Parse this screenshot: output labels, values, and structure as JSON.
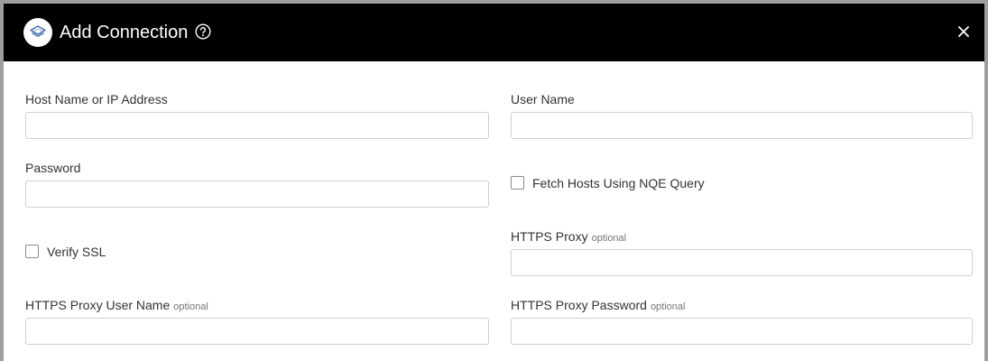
{
  "dialog": {
    "title": "Add Connection",
    "icons": {
      "logo": "layers-logo-icon",
      "help": "help-circle-icon",
      "close": "close-icon"
    }
  },
  "form": {
    "host": {
      "label": "Host Name or IP Address",
      "value": ""
    },
    "username": {
      "label": "User Name",
      "value": ""
    },
    "password": {
      "label": "Password",
      "value": ""
    },
    "fetch_hosts": {
      "label": "Fetch Hosts Using NQE Query",
      "checked": false
    },
    "verify_ssl": {
      "label": "Verify SSL",
      "checked": false
    },
    "https_proxy": {
      "label": "HTTPS Proxy",
      "optional": "optional",
      "value": ""
    },
    "proxy_username": {
      "label": "HTTPS Proxy User Name",
      "optional": "optional",
      "value": ""
    },
    "proxy_password": {
      "label": "HTTPS Proxy Password",
      "optional": "optional",
      "value": ""
    }
  },
  "colors": {
    "header_bg": "#000000",
    "frame_border": "#9e9e9e",
    "logo_accent": "#3d6fb0"
  }
}
